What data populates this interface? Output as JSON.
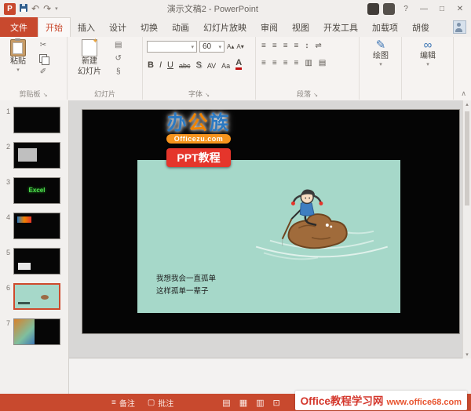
{
  "titlebar": {
    "logo": "P",
    "title": "演示文稿2 - PowerPoint"
  },
  "tabs": {
    "file": "文件",
    "home": "开始",
    "insert": "插入",
    "design": "设计",
    "transitions": "切换",
    "animations": "动画",
    "slideshow": "幻灯片放映",
    "review": "审阅",
    "view": "视图",
    "developer": "开发工具",
    "addins": "加载项",
    "account": "胡俊"
  },
  "ribbon": {
    "paste": "粘贴",
    "new_slide_l1": "新建",
    "new_slide_l2": "幻灯片",
    "font_size": "60",
    "drawing": "绘图",
    "editing": "编辑",
    "bold": "B",
    "italic": "I",
    "underline": "U",
    "strike": "abc",
    "shadow": "S",
    "spacing": "AV",
    "case": "Aa",
    "color": "A",
    "groups": {
      "clipboard": "剪贴板",
      "slides": "幻灯片",
      "font": "字体",
      "paragraph": "段落"
    }
  },
  "icons": {
    "caret": "▾",
    "launcher": "↘",
    "collapse": "∧",
    "min": "—",
    "max": "□",
    "close": "✕",
    "help": "?",
    "undo": "↶",
    "redo": "↷",
    "cut": "✂",
    "format_painter": "✐",
    "layout": "▤",
    "reset": "↺",
    "section": "§",
    "inc_font": "A▴",
    "dec_font": "A▾",
    "lines": "≡",
    "updown": "↕",
    "swap": "⇌",
    "columns": "▥",
    "pencil": "✎",
    "binoculars": "∞",
    "speech": "▢",
    "view_normal": "▤",
    "view_sorter": "▦",
    "view_reading": "▥",
    "view_show": "⊡",
    "scroll_up": "▴",
    "scroll_down": "▾"
  },
  "thumbs": {
    "n1": "1",
    "n2": "2",
    "n3": "3",
    "n4": "4",
    "n5": "5",
    "n6": "6",
    "n7": "7",
    "slide3_text": "Excel"
  },
  "slide": {
    "brand_chars": [
      "办",
      "公",
      "族"
    ],
    "site": "Officezu.com",
    "badge": "PPT教程",
    "cap1": "我想我会一直孤单",
    "cap2": "这样孤单一辈子"
  },
  "status": {
    "notes": "备注",
    "comments": "批注"
  },
  "watermark": {
    "name": "Office教程学习网",
    "site": "www.office68.com"
  },
  "colors": {
    "accent": "#C8492E",
    "teal": "#A6D8C9",
    "badge": "#E5352B",
    "orange": "#F7941D"
  }
}
